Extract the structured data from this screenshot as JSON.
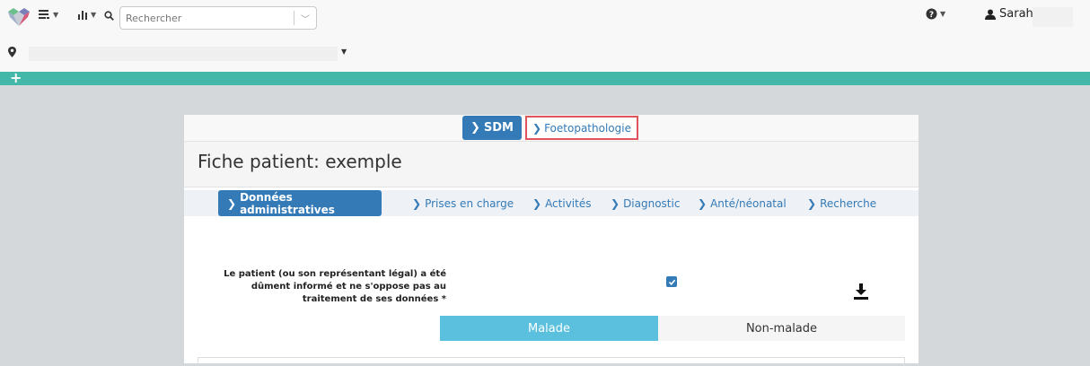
{
  "topbar": {
    "search_placeholder": "Rechercher",
    "user_name": "Sarah",
    "icons": {
      "logo": "logo-icon",
      "list_menu": "list-icon",
      "stats_menu": "bar-chart-icon",
      "search": "search-icon",
      "help": "question-circle-icon",
      "user": "user-icon",
      "location": "map-pin-icon"
    }
  },
  "colors": {
    "teal": "#44b8a8",
    "primary": "#337ab7",
    "info": "#5bc0de",
    "highlight": "#e0545b"
  },
  "site_tabs": [
    {
      "label": "SDM"
    },
    {
      "label": "Foetopathologie"
    }
  ],
  "page_title": "Fiche patient: exemple",
  "subtabs": [
    {
      "label": "Données administratives"
    },
    {
      "label": "Prises en charge"
    },
    {
      "label": "Activités"
    },
    {
      "label": "Diagnostic"
    },
    {
      "label": "Anté/néonatal"
    },
    {
      "label": "Recherche"
    }
  ],
  "consent": {
    "line1": "Le patient (ou son représentant légal) a été",
    "line2": "dûment informé et ne s'oppose pas au",
    "line3": "traitement de ses données *",
    "checked": true
  },
  "status_toggle": {
    "malade": "Malade",
    "non_malade": "Non-malade",
    "selected": "Malade"
  }
}
